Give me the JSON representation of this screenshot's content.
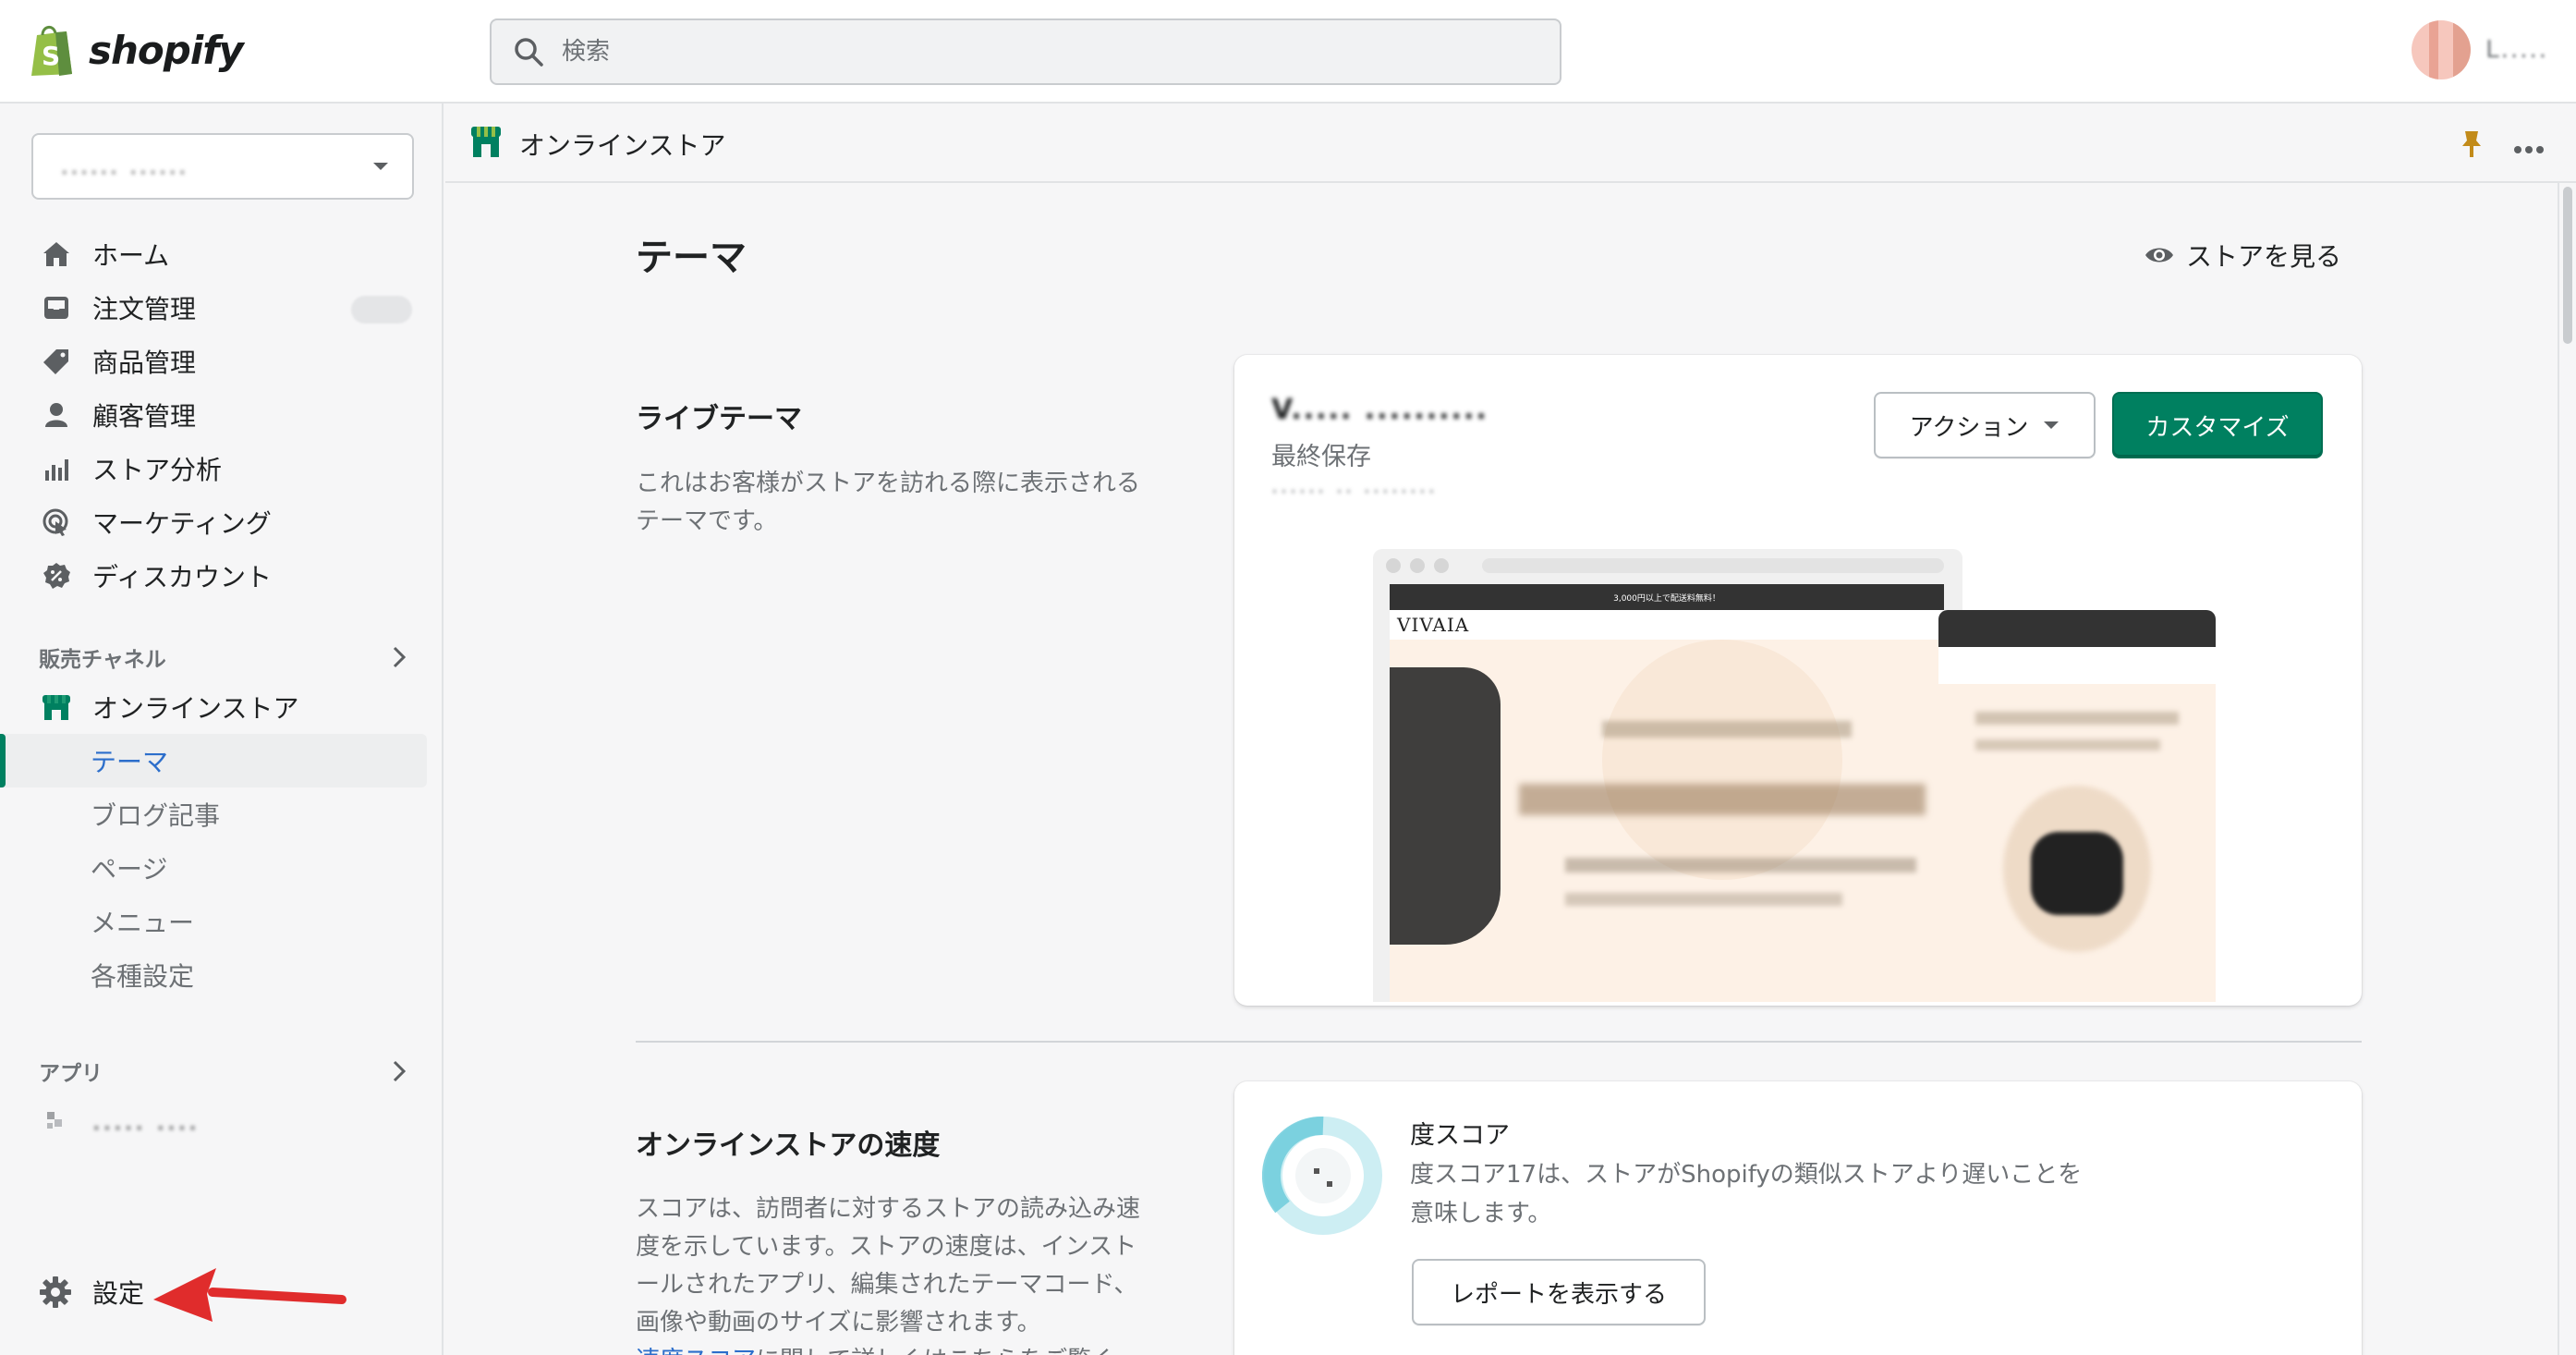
{
  "topbar": {
    "brand": "shopify",
    "search_placeholder": "検索",
    "user_name": "L....."
  },
  "sidebar": {
    "store_name": "...... ......",
    "nav": [
      {
        "label": "ホーム",
        "icon": "home-icon"
      },
      {
        "label": "注文管理",
        "icon": "inbox-icon"
      },
      {
        "label": "商品管理",
        "icon": "tag-icon"
      },
      {
        "label": "顧客管理",
        "icon": "person-icon"
      },
      {
        "label": "ストア分析",
        "icon": "bar-chart-icon"
      },
      {
        "label": "マーケティング",
        "icon": "target-icon"
      },
      {
        "label": "ディスカウント",
        "icon": "discount-icon"
      }
    ],
    "sales_channels_heading": "販売チャネル",
    "online_store": "オンラインストア",
    "online_store_sub": [
      "テーマ",
      "ブログ記事",
      "ページ",
      "メニュー",
      "各種設定"
    ],
    "apps_heading": "アプリ",
    "app_name": "..... ....",
    "settings": "設定"
  },
  "subbar": {
    "title": "オンラインストア"
  },
  "main": {
    "page_title": "テーマ",
    "view_store": "ストアを見る",
    "live_theme": {
      "heading": "ライブテーマ",
      "description": "これはお客様がストアを訪れる際に表示されるテーマです。",
      "theme_name": "V..... ..........",
      "last_saved": "最終保存",
      "version_line": "...... .. ........",
      "actions_button": "アクション",
      "customize_button": "カスタマイズ",
      "preview_banner": "3,000円以上で配送料無料！",
      "preview_logo": "VIVAIA"
    },
    "speed": {
      "heading": "オンラインストアの速度",
      "description": "スコアは、訪問者に対するストアの読み込み速度を示しています。ストアの速度は、インストールされたアプリ、編集されたテーマコード、画像や動画のサイズに影響されます。",
      "link_text": "速度スコア",
      "link_suffix": "に関して詳しくはこちらをご覧く",
      "score_title": "度スコア",
      "score_text": "度スコア17は、ストアがShopifyの類似ストアより遅いことを意味します。",
      "report_button": "レポートを表示する"
    }
  },
  "colors": {
    "brand_green": "#008060",
    "shopify_green": "#95bf47",
    "annotation_red": "#e02c2c"
  }
}
